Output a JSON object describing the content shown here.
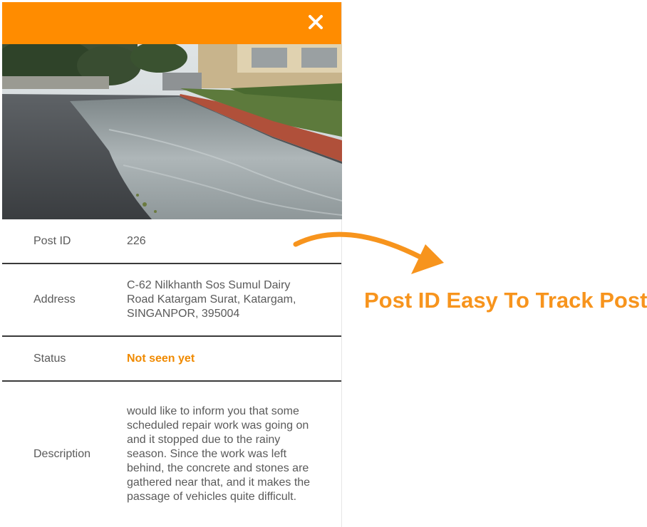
{
  "header": {
    "close_icon": "close-icon",
    "color": "#ff8c00"
  },
  "photo": {
    "subject": "flooded road photo"
  },
  "details": {
    "post_id_label": "Post ID",
    "post_id_value": "226",
    "address_label": "Address",
    "address_value": "C-62 Nilkhanth Sos Sumul Dairy Road Katargam Surat, Katargam, SINGANPOR, 395004",
    "status_label": "Status",
    "status_value": "Not seen yet",
    "description_label": "Description",
    "description_value": "would like to inform you that some scheduled repair work was going on and it stopped due to the rainy season. Since the work was left behind, the concrete and stones are gathered near that, and it makes the passage of vehicles quite difficult."
  },
  "callout": {
    "text": "Post ID Easy To Track Post",
    "color": "#f7941d"
  }
}
